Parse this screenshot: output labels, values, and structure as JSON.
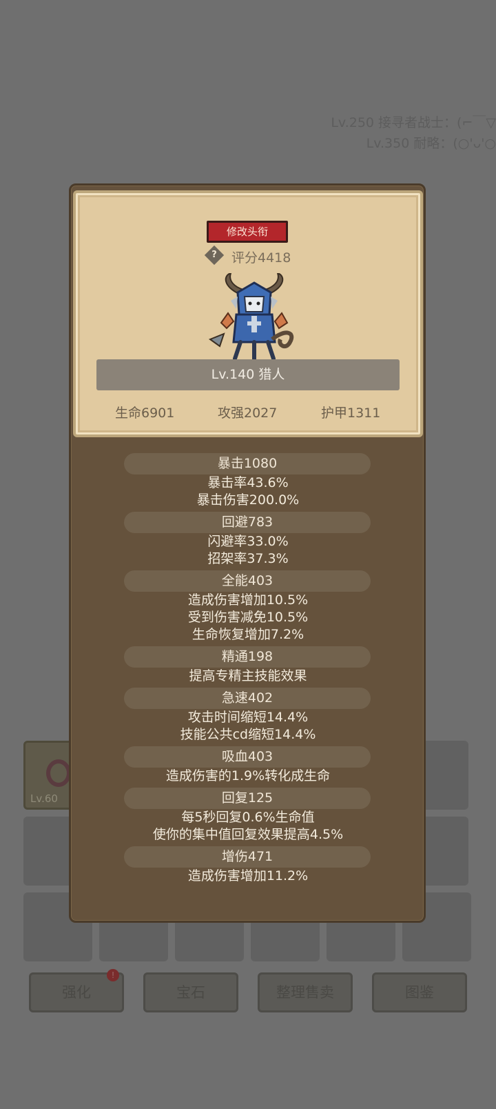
{
  "background": {
    "ticker_lines": [
      "Lv.250 接寻者战士：(⌐￣▽",
      "Lv.350 耐略：(○'ᴗ'○"
    ],
    "item_slot_level": "Lv.60",
    "bottom_buttons": [
      {
        "label": "强化",
        "badge": "!"
      },
      {
        "label": "宝石"
      },
      {
        "label": "整理售卖"
      },
      {
        "label": "图鉴"
      }
    ]
  },
  "profile": {
    "change_title_button": "修改头衔",
    "help_icon_glyph": "?",
    "score": "评分4418",
    "name": "Lv.140 猎人",
    "main_stats": {
      "hp": "生命6901",
      "attack": "攻强2027",
      "armor": "护甲1311"
    }
  },
  "stats": [
    {
      "head": "暴击1080",
      "lines": [
        "暴击率43.6%",
        "暴击伤害200.0%"
      ]
    },
    {
      "head": "回避783",
      "lines": [
        "闪避率33.0%",
        "招架率37.3%"
      ]
    },
    {
      "head": "全能403",
      "lines": [
        "造成伤害增加10.5%",
        "受到伤害减免10.5%",
        "生命恢复增加7.2%"
      ]
    },
    {
      "head": "精通198",
      "lines": [
        "提高专精主技能效果"
      ]
    },
    {
      "head": "急速402",
      "lines": [
        "攻击时间缩短14.4%",
        "技能公共cd缩短14.4%"
      ]
    },
    {
      "head": "吸血403",
      "lines": [
        "造成伤害的1.9%转化成生命"
      ]
    },
    {
      "head": "回复125",
      "lines": [
        "每5秒回复0.6%生命值",
        "使你的集中值回复效果提高4.5%"
      ]
    },
    {
      "head": "增伤471",
      "lines": [
        "造成伤害增加11.2%"
      ]
    }
  ],
  "colors": {
    "overlay": "#6f6f6f",
    "panel": "#65523c",
    "card": "#e1caa0",
    "title_button": "#b3262b",
    "name_bar": "#8b8378"
  }
}
